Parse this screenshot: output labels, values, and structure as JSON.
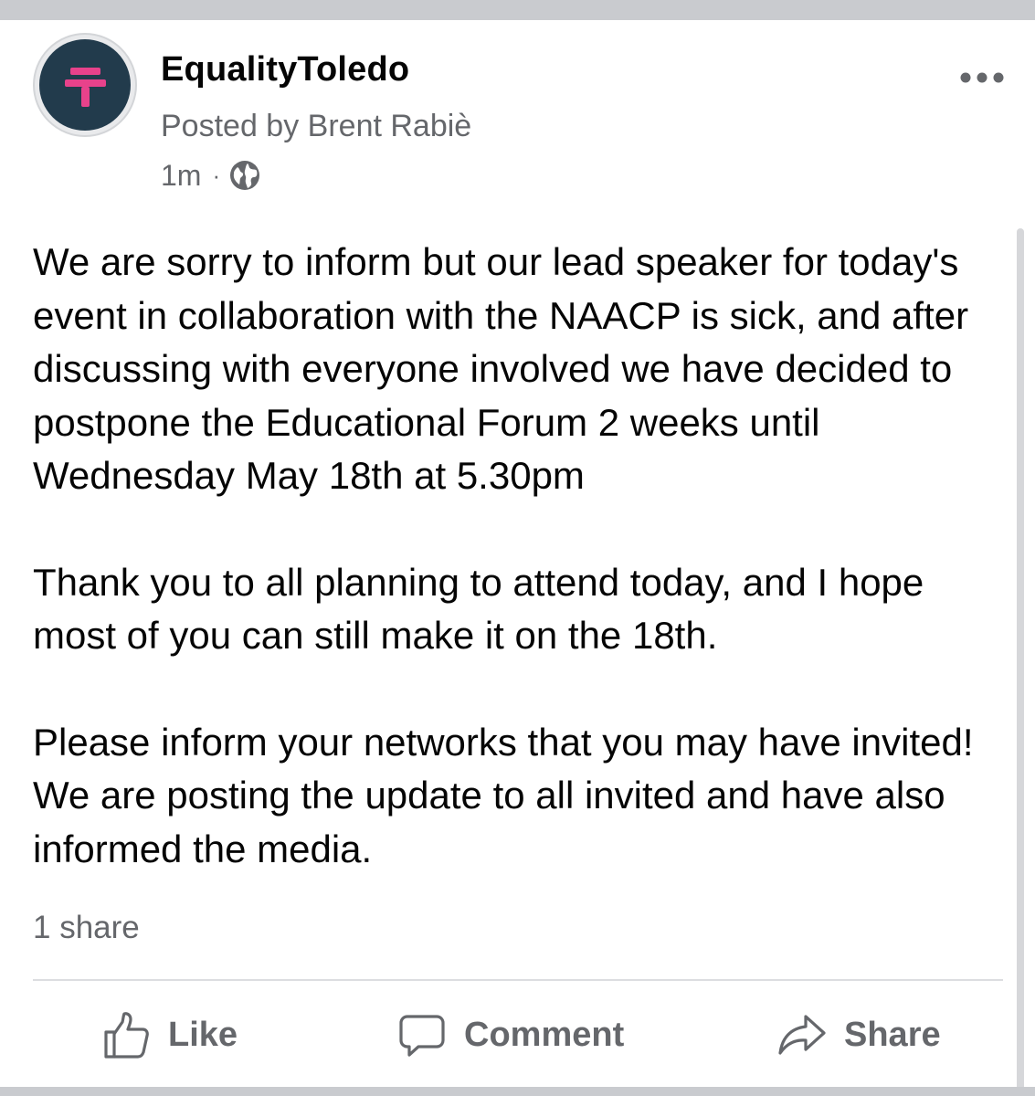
{
  "post": {
    "page_name": "EqualityToledo",
    "posted_by": "Posted by Brent Rabiè",
    "time": "1m",
    "separator": "·",
    "privacy_icon": "globe-icon",
    "paragraphs": [
      "We are sorry to inform but our lead speaker for today's event in collaboration with the NAACP is sick, and after discussing with everyone involved we have decided to postpone the Educational Forum 2 weeks until Wednesday May 18th at 5.30pm",
      "Thank you to all planning to attend today, and I hope most of you can still make it on the 18th.",
      "Please inform your networks that you may have invited! We are posting the update to all invited and have also informed the media."
    ],
    "share_count": "1 share"
  },
  "actions": {
    "like_label": "Like",
    "comment_label": "Comment",
    "share_label": "Share"
  },
  "colors": {
    "avatar_bg": "#223b4c",
    "avatar_logo": "#e8428b",
    "secondary_text": "#65676b",
    "primary_text": "#050505"
  }
}
